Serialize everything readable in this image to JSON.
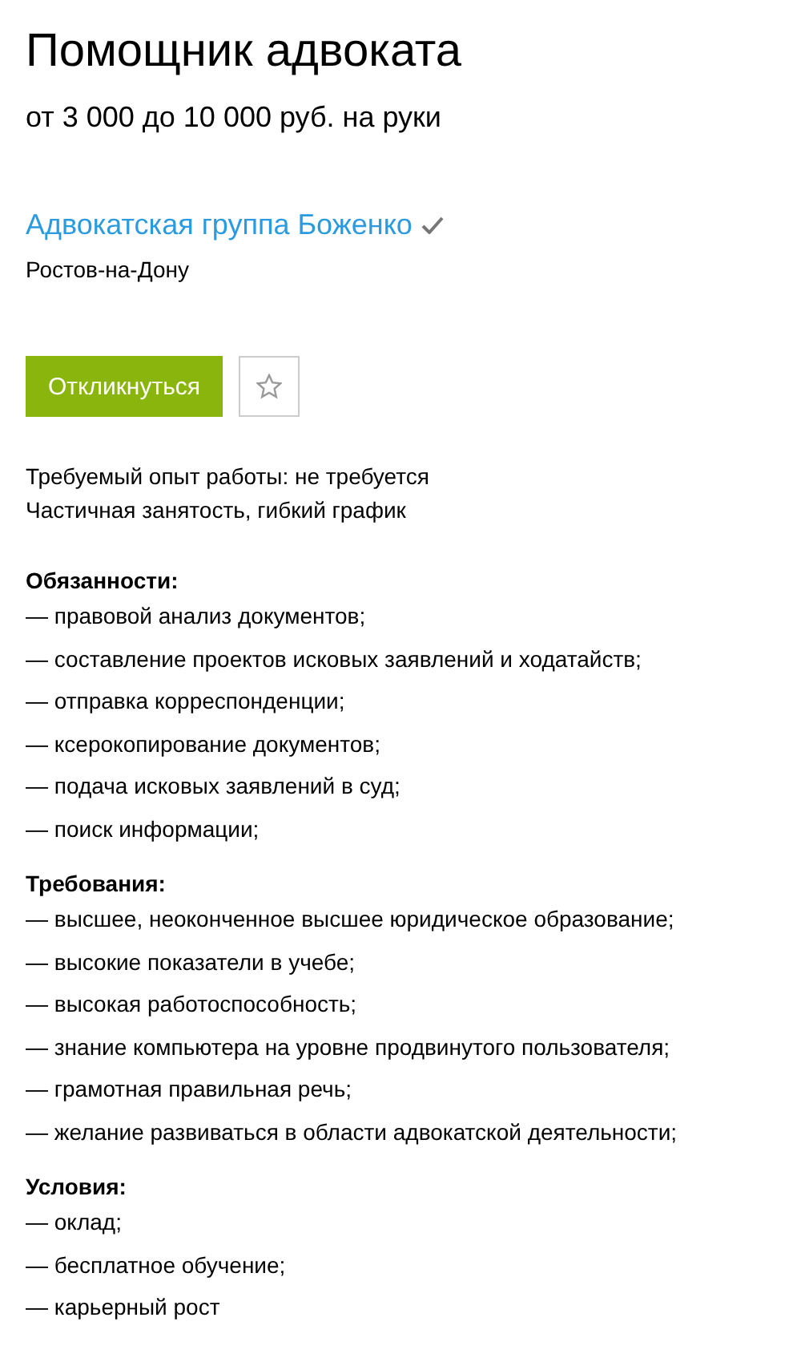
{
  "vacancy": {
    "title": "Помощник адвоката",
    "salary": "от 3 000 до 10 000 руб. на руки"
  },
  "company": {
    "name": "Адвокатская группа Боженко",
    "verified": true,
    "city": "Ростов-на-Дону"
  },
  "actions": {
    "apply_button": "Откликнуться",
    "favorite": false
  },
  "details": [
    "Требуемый опыт работы: не требуется",
    "Частичная занятость, гибкий график"
  ],
  "sections": [
    {
      "heading": "Обязанности:",
      "items": [
        "— правовой анализ документов;",
        "— составление проектов исковых заявлений и ходатайств;",
        "— отправка корреспонденции;",
        "— ксерокопирование документов;",
        "— подача исковых заявлений в суд;",
        "— поиск информации;"
      ]
    },
    {
      "heading": "Требования:",
      "items": [
        "— высшее, неоконченное высшее юридическое образование;",
        "— высокие показатели в учебе;",
        "— высокая работоспособность;",
        "— знание компьютера на уровне продвинутого пользователя;",
        "— грамотная правильная речь;",
        "— желание развиваться в области адвокатской деятельности;"
      ]
    },
    {
      "heading": "Условия:",
      "items": [
        "— оклад;",
        "— бесплатное обучение;",
        "— карьерный рост"
      ]
    }
  ]
}
